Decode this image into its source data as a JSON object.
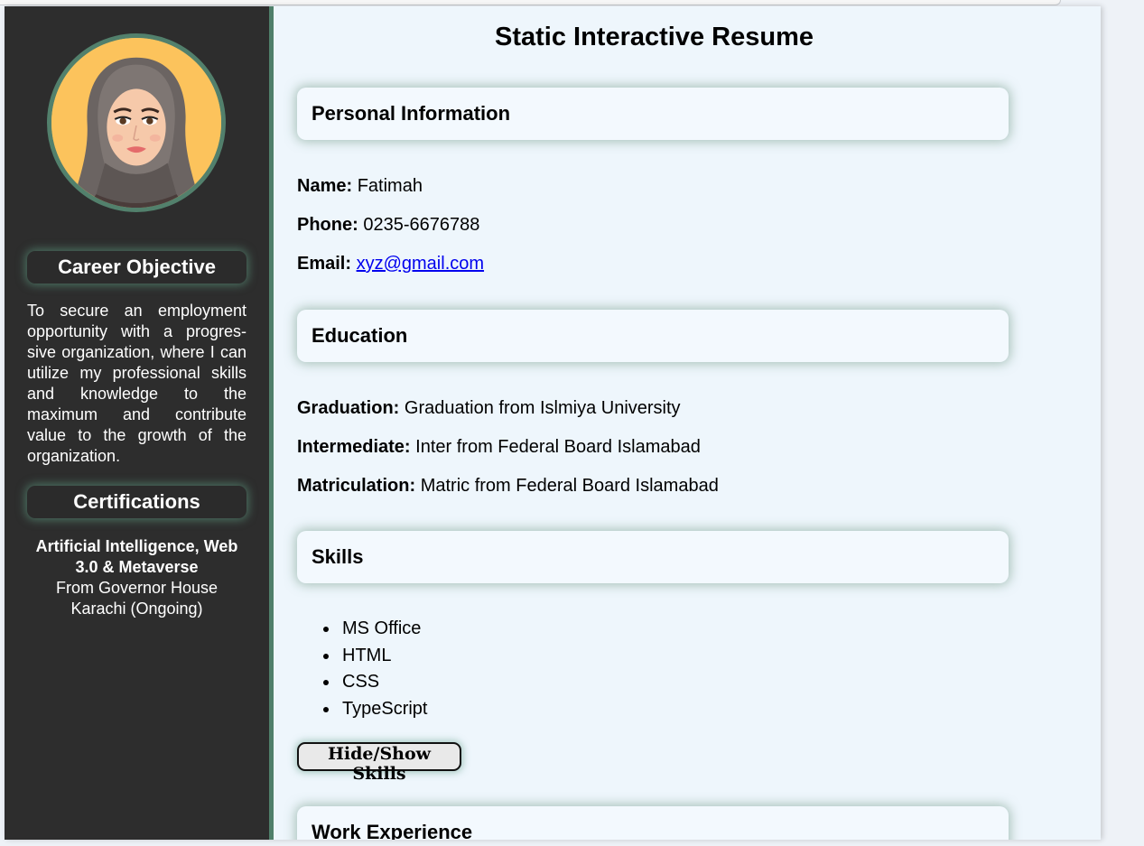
{
  "sidebar": {
    "career_heading": "Career Objective",
    "career_text": "To secure an employment opportunity with a progres-sive organization, where I can utilize my professional skills and knowledge to the maximum and contribute value to the growth of the organization.",
    "cert_heading": "Certifications",
    "cert_title": "Artificial Intelligence, Web 3.0 & Metaverse",
    "cert_detail": "From Governor House Karachi (Ongoing)"
  },
  "main": {
    "title": "Static Interactive Resume",
    "personal": {
      "heading": "Personal Information",
      "name_label": "Name:",
      "name": "Fatimah",
      "phone_label": "Phone:",
      "phone": "0235-6676788",
      "email_label": "Email:",
      "email": "xyz@gmail.com"
    },
    "education": {
      "heading": "Education",
      "graduation_label": "Graduation:",
      "graduation": "Graduation from Islmiya University",
      "intermediate_label": "Intermediate:",
      "intermediate": "Inter from Federal Board Islamabad",
      "matric_label": "Matriculation:",
      "matric": "Matric from Federal Board Islamabad"
    },
    "skills": {
      "heading": "Skills",
      "items": [
        "MS Office",
        "HTML",
        "CSS",
        "TypeScript"
      ],
      "toggle_label": "Hide/Show Skills"
    },
    "work": {
      "heading": "Work Experience"
    }
  },
  "colors": {
    "sidebar_bg": "#2d2d2d",
    "accent_green": "#4f7f6a",
    "main_bg": "#eef6fc",
    "link": "#0000ee"
  }
}
